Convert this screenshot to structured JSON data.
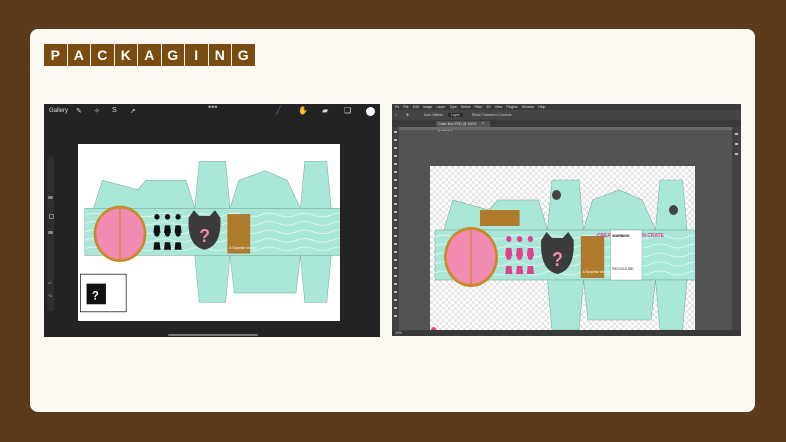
{
  "slide": {
    "title_letters": [
      "P",
      "A",
      "C",
      "K",
      "A",
      "G",
      "I",
      "N",
      "G"
    ]
  },
  "procreate": {
    "gallery_label": "Gallery",
    "left_tools": [
      "wrench-icon",
      "magic-wand-icon",
      "selection-icon",
      "transform-icon"
    ],
    "right_tools": [
      "brush-icon",
      "smudge-icon",
      "eraser-icon",
      "layers-icon",
      "color-icon"
    ],
    "accent_color": "#1e7fe0"
  },
  "box_art": {
    "turquoise": "#a9e8d9",
    "pink_door": "#f28bb2",
    "door_frame": "#c88b2a",
    "gold_panel": "#b07a2c",
    "magenta": "#e0418f",
    "mystery_mark": "?",
    "panel_text": "A Surprise Inside!",
    "headline_text": "CREATE YOUR OWN CRATE",
    "side_panel_title": "WARNING",
    "recycle_label": "RECYCLE ME!"
  },
  "photoshop": {
    "menu_items": [
      "Ps",
      "File",
      "Edit",
      "Image",
      "Layer",
      "Type",
      "Select",
      "Filter",
      "3D",
      "View",
      "Plugins",
      "Window",
      "Help"
    ],
    "options": {
      "auto_select": "Auto-Select:",
      "layer": "Layer",
      "show_transform": "Show Transform Controls"
    },
    "doc_tab": "Outer Box.PSD @ 100% (RGB/8*)",
    "status": "26%"
  }
}
